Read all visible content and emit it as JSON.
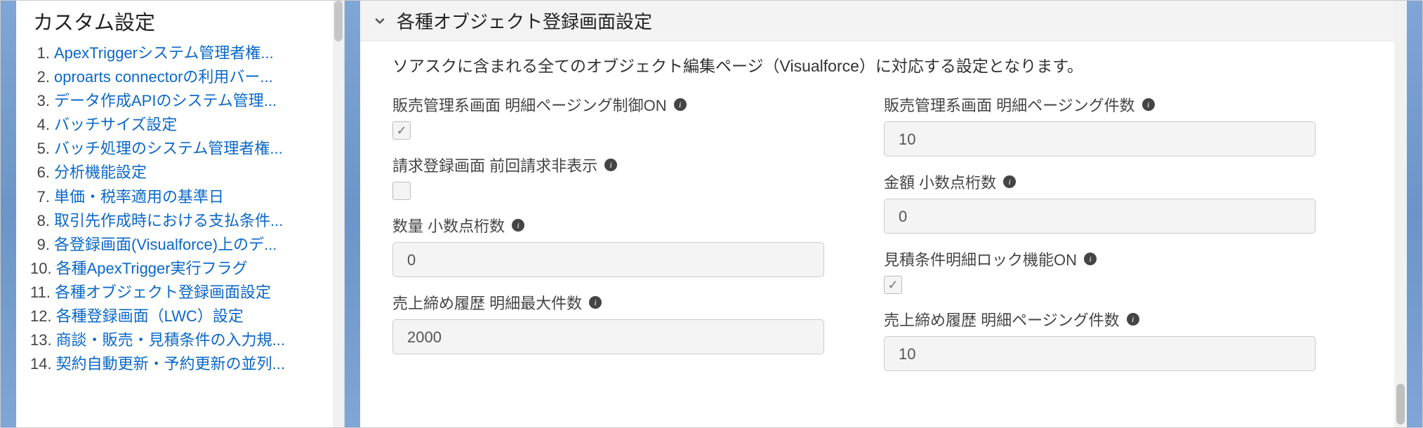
{
  "sidebar": {
    "title": "カスタム設定",
    "items": [
      {
        "num": "1.",
        "label": "ApexTriggerシステム管理者権..."
      },
      {
        "num": "2.",
        "label": "oproarts connectorの利用バー..."
      },
      {
        "num": "3.",
        "label": "データ作成APIのシステム管理..."
      },
      {
        "num": "4.",
        "label": "バッチサイズ設定"
      },
      {
        "num": "5.",
        "label": "バッチ処理のシステム管理者権..."
      },
      {
        "num": "6.",
        "label": "分析機能設定"
      },
      {
        "num": "7.",
        "label": "単価・税率適用の基準日"
      },
      {
        "num": "8.",
        "label": "取引先作成時における支払条件..."
      },
      {
        "num": "9.",
        "label": "各登録画面(Visualforce)上のデ..."
      },
      {
        "num": "10.",
        "label": "各種ApexTrigger実行フラグ"
      },
      {
        "num": "11.",
        "label": "各種オブジェクト登録画面設定"
      },
      {
        "num": "12.",
        "label": "各種登録画面（LWC）設定"
      },
      {
        "num": "13.",
        "label": "商談・販売・見積条件の入力規..."
      },
      {
        "num": "14.",
        "label": "契約自動更新・予約更新の並列..."
      }
    ]
  },
  "main": {
    "section_title": "各種オブジェクト登録画面設定",
    "section_desc": "ソアスクに含まれる全てのオブジェクト編集ページ（Visualforce）に対応する設定となります。",
    "left_fields": [
      {
        "label": "販売管理系画面 明細ページング制御ON",
        "type": "checkbox",
        "checked": true
      },
      {
        "label": "請求登録画面 前回請求非表示",
        "type": "checkbox",
        "checked": false
      },
      {
        "label": "数量 小数点桁数",
        "type": "text",
        "value": "0"
      },
      {
        "label": "売上締め履歴 明細最大件数",
        "type": "text",
        "value": "2000"
      }
    ],
    "right_fields": [
      {
        "label": "販売管理系画面 明細ページング件数",
        "type": "text",
        "value": "10"
      },
      {
        "label": "金額 小数点桁数",
        "type": "text",
        "value": "0"
      },
      {
        "label": "見積条件明細ロック機能ON",
        "type": "checkbox",
        "checked": true
      },
      {
        "label": "売上締め履歴 明細ページング件数",
        "type": "text",
        "value": "10"
      }
    ]
  }
}
